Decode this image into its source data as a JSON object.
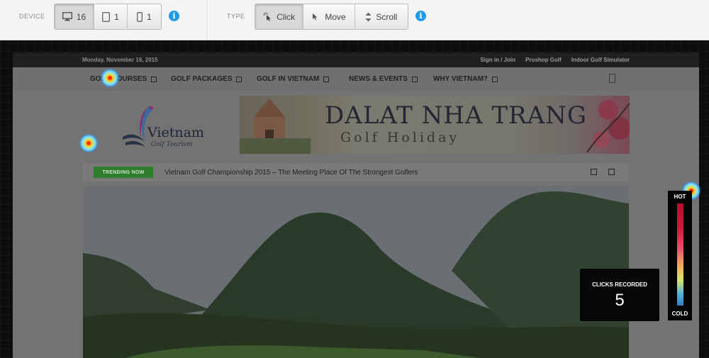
{
  "toolbar": {
    "device_label": "DEVICE",
    "devices": [
      {
        "icon": "desktop-icon",
        "count": "16"
      },
      {
        "icon": "tablet-icon",
        "count": "1"
      },
      {
        "icon": "phone-icon",
        "count": "1"
      }
    ],
    "type_label": "TYPE",
    "types": [
      {
        "icon": "click-cursor-icon",
        "label": "Click",
        "active": true
      },
      {
        "icon": "move-cursor-icon",
        "label": "Move",
        "active": false
      },
      {
        "icon": "scroll-icon",
        "label": "Scroll",
        "active": false
      }
    ],
    "info_glyph": "i"
  },
  "site": {
    "date": "Monday, November 16, 2015",
    "top_links": [
      "Sign in / Join",
      "Proshop Golf",
      "Indoor Golf Simulator"
    ],
    "nav": [
      "GOLF COURSES",
      "GOLF PACKAGES",
      "GOLF IN VIETNAM",
      "NEWS & EVENTS",
      "WHY VIETNAM?"
    ],
    "logo_text": "Vietnam",
    "logo_sub": "Golf Tourism",
    "banner_title": "DALAT  NHA TRANG",
    "banner_sub": "Golf Holiday",
    "trending_label": "TRENDING NOW",
    "trending_text": "Vietnam Golf Championship 2015 – The Meeting Place Of The Strongest Golfers"
  },
  "legend": {
    "hot": "HOT",
    "cold": "COLD"
  },
  "counter": {
    "label": "CLICKS RECORDED",
    "value": "5"
  },
  "colors": {
    "info": "#1e9ae8",
    "trending": "#2d7d2d"
  }
}
